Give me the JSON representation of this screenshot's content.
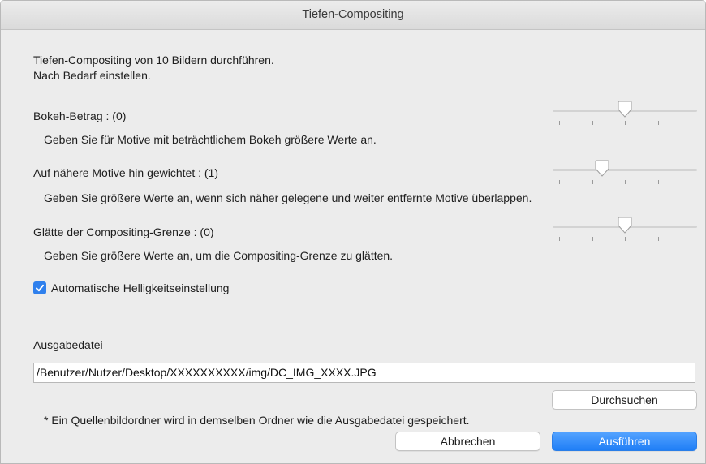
{
  "window": {
    "title": "Tiefen-Compositing"
  },
  "intro": {
    "line1": "Tiefen-Compositing von 10 Bildern durchführen.",
    "line2": "Nach Bedarf einstellen."
  },
  "settings": [
    {
      "label": "Bokeh-Betrag : (0)",
      "hint": "Geben Sie für Motive mit beträchtlichem Bokeh größere Werte an.",
      "value_fraction": 0.5
    },
    {
      "label": "Auf nähere Motive hin gewichtet : (1)",
      "hint": "Geben Sie größere Werte an, wenn sich näher gelegene und weiter entfernte Motive überlappen.",
      "value_fraction": 0.33
    },
    {
      "label": "Glätte der Compositing-Grenze : (0)",
      "hint": "Geben Sie größere Werte an, um die Compositing-Grenze zu glätten.",
      "value_fraction": 0.5
    }
  ],
  "auto_brightness": {
    "label": "Automatische Helligkeitseinstellung",
    "checked": true
  },
  "output": {
    "label": "Ausgabedatei",
    "path": "/Benutzer/Nutzer/Desktop/XXXXXXXXXX/img/DC_IMG_XXXX.JPG",
    "browse_label": "Durchsuchen",
    "note": "* Ein Quellenbildordner wird in demselben Ordner wie die Ausgabedatei gespeichert."
  },
  "buttons": {
    "cancel": "Abbrechen",
    "run": "Ausführen"
  },
  "colors": {
    "accent": "#2f80ed",
    "window_bg": "#ececec"
  }
}
